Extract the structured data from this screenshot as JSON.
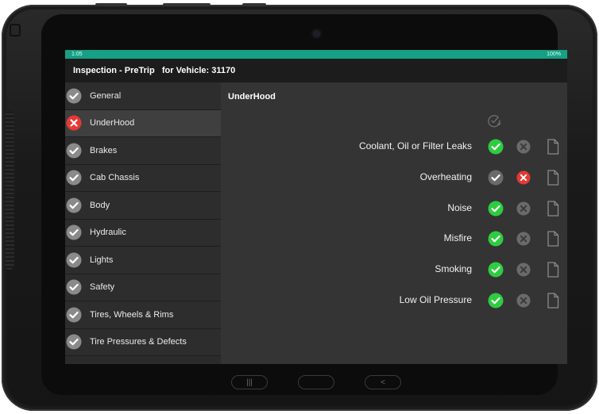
{
  "status_bar": {
    "time": "1:05",
    "right": "100%"
  },
  "header": {
    "title": "Inspection - PreTrip   for Vehicle: 31170"
  },
  "sidebar": {
    "items": [
      {
        "label": "General",
        "status": "pass"
      },
      {
        "label": "UnderHood",
        "status": "fail"
      },
      {
        "label": "Brakes",
        "status": "pass"
      },
      {
        "label": "Cab Chassis",
        "status": "pass"
      },
      {
        "label": "Body",
        "status": "pass"
      },
      {
        "label": "Hydraulic",
        "status": "pass"
      },
      {
        "label": "Lights",
        "status": "pass"
      },
      {
        "label": "Safety",
        "status": "pass"
      },
      {
        "label": "Tires, Wheels & Rims",
        "status": "pass"
      },
      {
        "label": "Tire Pressures & Defects",
        "status": "pass"
      }
    ]
  },
  "main": {
    "section_title": "UnderHood",
    "items": [
      {
        "label": "Coolant, Oil or Filter Leaks",
        "result": "pass"
      },
      {
        "label": "Overheating",
        "result": "fail"
      },
      {
        "label": "Noise",
        "result": "pass"
      },
      {
        "label": "Misfire",
        "result": "pass"
      },
      {
        "label": "Smoking",
        "result": "pass"
      },
      {
        "label": "Low Oil Pressure",
        "result": "pass"
      }
    ]
  },
  "navigation": {
    "recents": "|||",
    "home": "",
    "back": "<"
  },
  "colors": {
    "accent": "#16a085",
    "pass_active": "#2ecc40",
    "fail_active": "#e53935",
    "inactive": "#8a8a8a"
  }
}
